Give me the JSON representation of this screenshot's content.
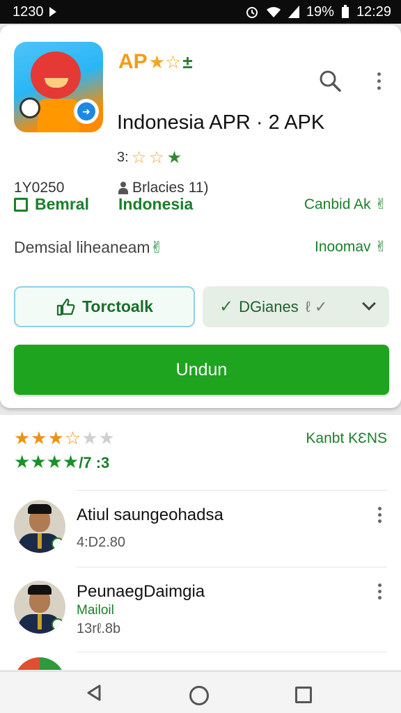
{
  "status_bar": {
    "time_left": "1230",
    "battery": "19%",
    "time_right": "12:29",
    "icons": [
      "play-icon",
      "alarm-icon",
      "wifi-icon",
      "signal-icon",
      "battery-icon"
    ]
  },
  "app": {
    "short_name": "AP",
    "header_stars": "★☆",
    "header_mark": "±",
    "title": "Indonesia APR · 2 APK",
    "rating_prefix": "3:",
    "rating_stars": [
      "☆",
      "☆",
      "★"
    ],
    "meta_left": "1Y0250",
    "meta_mid": "Brlacies",
    "meta_mid_suffix": "11)",
    "category": "Bemral",
    "region": "Indonesia",
    "right_1": "Canbid Ak ✌",
    "desc": "Demsial liheaneam",
    "desc_mark": "✌",
    "right_2": "Inoomav ✌"
  },
  "buttons": {
    "outline_label": "Torctoalk",
    "secondary_label": "DGianes",
    "secondary_suffix": "ℓ ✓",
    "install_label": "Undun"
  },
  "summary": {
    "stars_filled": "★★★☆",
    "stars_empty": "★★",
    "right_label": "Kanbt KƐNS",
    "line2_stars": "★★★★",
    "line2_text": "/7 :3"
  },
  "reviews": [
    {
      "name": "Atiul saungeohadsa",
      "sub": "",
      "date": "4:D2.80"
    },
    {
      "name": "PeunaegDaimgia",
      "sub": "Mailoil",
      "date": "13rℓ.8b"
    }
  ],
  "colors": {
    "accent_green": "#1ea41e",
    "title_orange": "#f39c12",
    "star_orange": "#f5a623",
    "link_green": "#1a7f2a"
  }
}
